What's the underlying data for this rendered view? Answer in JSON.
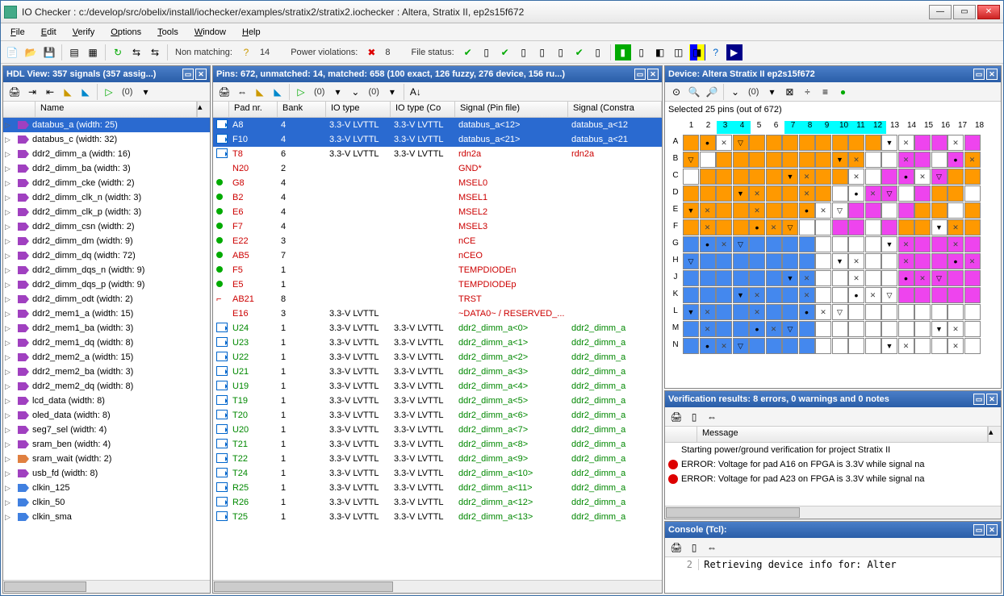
{
  "window": {
    "title": "IO Checker : c:/develop/src/obelix/install/iochecker/examples/stratix2/stratix2.iochecker : Altera, Stratix II, ep2s15f672"
  },
  "menu": [
    "File",
    "Edit",
    "Verify",
    "Options",
    "Tools",
    "Window",
    "Help"
  ],
  "toolbar": {
    "nonmatching_label": "Non matching:",
    "nonmatching_count": "14",
    "power_label": "Power violations:",
    "power_count": "8",
    "file_label": "File status:"
  },
  "hdl": {
    "title": "HDL View: 357 signals (357 assig...)",
    "filter_count": "(0)",
    "colhdr": "Name",
    "signals": [
      {
        "name": "databus_a (width: 25)",
        "icon": "purple",
        "sel": true
      },
      {
        "name": "databus_c (width: 32)",
        "icon": "purple"
      },
      {
        "name": "ddr2_dimm_a (width: 16)",
        "icon": "purple"
      },
      {
        "name": "ddr2_dimm_ba (width: 3)",
        "icon": "purple"
      },
      {
        "name": "ddr2_dimm_cke (width: 2)",
        "icon": "purple"
      },
      {
        "name": "ddr2_dimm_clk_n (width: 3)",
        "icon": "purple"
      },
      {
        "name": "ddr2_dimm_clk_p (width: 3)",
        "icon": "purple"
      },
      {
        "name": "ddr2_dimm_csn (width: 2)",
        "icon": "purple"
      },
      {
        "name": "ddr2_dimm_dm (width: 9)",
        "icon": "purple"
      },
      {
        "name": "ddr2_dimm_dq (width: 72)",
        "icon": "purple"
      },
      {
        "name": "ddr2_dimm_dqs_n (width: 9)",
        "icon": "purple"
      },
      {
        "name": "ddr2_dimm_dqs_p (width: 9)",
        "icon": "purple"
      },
      {
        "name": "ddr2_dimm_odt (width: 2)",
        "icon": "purple"
      },
      {
        "name": "ddr2_mem1_a (width: 15)",
        "icon": "purple"
      },
      {
        "name": "ddr2_mem1_ba (width: 3)",
        "icon": "purple"
      },
      {
        "name": "ddr2_mem1_dq (width: 8)",
        "icon": "purple"
      },
      {
        "name": "ddr2_mem2_a (width: 15)",
        "icon": "purple"
      },
      {
        "name": "ddr2_mem2_ba (width: 3)",
        "icon": "purple"
      },
      {
        "name": "ddr2_mem2_dq (width: 8)",
        "icon": "purple"
      },
      {
        "name": "lcd_data (width: 8)",
        "icon": "purple"
      },
      {
        "name": "oled_data (width: 8)",
        "icon": "purple"
      },
      {
        "name": "seg7_sel (width: 4)",
        "icon": "purple"
      },
      {
        "name": "sram_ben (width: 4)",
        "icon": "purple"
      },
      {
        "name": "sram_wait (width: 2)",
        "icon": "orange"
      },
      {
        "name": "usb_fd (width: 8)",
        "icon": "purple"
      },
      {
        "name": "clkin_125",
        "icon": "blue"
      },
      {
        "name": "clkin_50",
        "icon": "blue"
      },
      {
        "name": "clkin_sma",
        "icon": "blue"
      }
    ]
  },
  "pins": {
    "title": "Pins: 672, unmatched: 14, matched: 658 (100 exact, 126 fuzzy, 276 device, 156 ru...)",
    "filter1": "(0)",
    "filter2": "(0)",
    "cols": [
      "Pad nr.",
      "Bank",
      "IO type",
      "IO type (Co",
      "Signal (Pin file)",
      "Signal (Constra"
    ],
    "rows": [
      {
        "icon": "pin",
        "pad": "A8",
        "bank": "4",
        "io1": "3.3-V LVTTL",
        "io2": "3.3-V LVTTL",
        "sig1": "databus_a<12>",
        "sig2": "databus_a<12",
        "sel": true
      },
      {
        "icon": "pin",
        "pad": "F10",
        "bank": "4",
        "io1": "3.3-V LVTTL",
        "io2": "3.3-V LVTTL",
        "sig1": "databus_a<21>",
        "sig2": "databus_a<21",
        "sel": true
      },
      {
        "icon": "pin-red",
        "pad": "T8",
        "bank": "6",
        "io1": "3.3-V LVTTL",
        "io2": "3.3-V LVTTL",
        "sig1": "rdn2a",
        "sig2": "rdn2a",
        "cls": "red"
      },
      {
        "icon": "",
        "pad": "N20",
        "bank": "2",
        "io1": "",
        "io2": "",
        "sig1": "GND*",
        "sig2": "",
        "cls": "red"
      },
      {
        "icon": "dot",
        "pad": "G8",
        "bank": "4",
        "io1": "",
        "io2": "",
        "sig1": "MSEL0",
        "sig2": "",
        "cls": "red"
      },
      {
        "icon": "dot",
        "pad": "B2",
        "bank": "4",
        "io1": "",
        "io2": "",
        "sig1": "MSEL1",
        "sig2": "",
        "cls": "red"
      },
      {
        "icon": "dot",
        "pad": "E6",
        "bank": "4",
        "io1": "",
        "io2": "",
        "sig1": "MSEL2",
        "sig2": "",
        "cls": "red"
      },
      {
        "icon": "dot",
        "pad": "F7",
        "bank": "4",
        "io1": "",
        "io2": "",
        "sig1": "MSEL3",
        "sig2": "",
        "cls": "red"
      },
      {
        "icon": "dot",
        "pad": "E22",
        "bank": "3",
        "io1": "",
        "io2": "",
        "sig1": "nCE",
        "sig2": "",
        "cls": "red"
      },
      {
        "icon": "dot",
        "pad": "AB5",
        "bank": "7",
        "io1": "",
        "io2": "",
        "sig1": "nCEO",
        "sig2": "",
        "cls": "red"
      },
      {
        "icon": "dot",
        "pad": "F5",
        "bank": "1",
        "io1": "",
        "io2": "",
        "sig1": "TEMPDIODEn",
        "sig2": "",
        "cls": "red"
      },
      {
        "icon": "dot",
        "pad": "E5",
        "bank": "1",
        "io1": "",
        "io2": "",
        "sig1": "TEMPDIODEp",
        "sig2": "",
        "cls": "red"
      },
      {
        "icon": "step",
        "pad": "AB21",
        "bank": "8",
        "io1": "",
        "io2": "",
        "sig1": "TRST",
        "sig2": "",
        "cls": "red"
      },
      {
        "icon": "",
        "pad": "E16",
        "bank": "3",
        "io1": "3.3-V LVTTL",
        "io2": "",
        "sig1": "~DATA0~ / RESERVED_...",
        "sig2": "",
        "cls": "red"
      },
      {
        "icon": "pin-g",
        "pad": "U24",
        "bank": "1",
        "io1": "3.3-V LVTTL",
        "io2": "3.3-V LVTTL",
        "sig1": "ddr2_dimm_a<0>",
        "sig2": "ddr2_dimm_a",
        "cls": "green"
      },
      {
        "icon": "pin-g",
        "pad": "U23",
        "bank": "1",
        "io1": "3.3-V LVTTL",
        "io2": "3.3-V LVTTL",
        "sig1": "ddr2_dimm_a<1>",
        "sig2": "ddr2_dimm_a",
        "cls": "green"
      },
      {
        "icon": "pin-g",
        "pad": "U22",
        "bank": "1",
        "io1": "3.3-V LVTTL",
        "io2": "3.3-V LVTTL",
        "sig1": "ddr2_dimm_a<2>",
        "sig2": "ddr2_dimm_a",
        "cls": "green"
      },
      {
        "icon": "pin-g",
        "pad": "U21",
        "bank": "1",
        "io1": "3.3-V LVTTL",
        "io2": "3.3-V LVTTL",
        "sig1": "ddr2_dimm_a<3>",
        "sig2": "ddr2_dimm_a",
        "cls": "green"
      },
      {
        "icon": "pin-g",
        "pad": "U19",
        "bank": "1",
        "io1": "3.3-V LVTTL",
        "io2": "3.3-V LVTTL",
        "sig1": "ddr2_dimm_a<4>",
        "sig2": "ddr2_dimm_a",
        "cls": "green"
      },
      {
        "icon": "pin-g",
        "pad": "T19",
        "bank": "1",
        "io1": "3.3-V LVTTL",
        "io2": "3.3-V LVTTL",
        "sig1": "ddr2_dimm_a<5>",
        "sig2": "ddr2_dimm_a",
        "cls": "green"
      },
      {
        "icon": "pin-g",
        "pad": "T20",
        "bank": "1",
        "io1": "3.3-V LVTTL",
        "io2": "3.3-V LVTTL",
        "sig1": "ddr2_dimm_a<6>",
        "sig2": "ddr2_dimm_a",
        "cls": "green"
      },
      {
        "icon": "pin-g",
        "pad": "U20",
        "bank": "1",
        "io1": "3.3-V LVTTL",
        "io2": "3.3-V LVTTL",
        "sig1": "ddr2_dimm_a<7>",
        "sig2": "ddr2_dimm_a",
        "cls": "green"
      },
      {
        "icon": "pin-g",
        "pad": "T21",
        "bank": "1",
        "io1": "3.3-V LVTTL",
        "io2": "3.3-V LVTTL",
        "sig1": "ddr2_dimm_a<8>",
        "sig2": "ddr2_dimm_a",
        "cls": "green"
      },
      {
        "icon": "pin-g",
        "pad": "T22",
        "bank": "1",
        "io1": "3.3-V LVTTL",
        "io2": "3.3-V LVTTL",
        "sig1": "ddr2_dimm_a<9>",
        "sig2": "ddr2_dimm_a",
        "cls": "green"
      },
      {
        "icon": "pin-g",
        "pad": "T24",
        "bank": "1",
        "io1": "3.3-V LVTTL",
        "io2": "3.3-V LVTTL",
        "sig1": "ddr2_dimm_a<10>",
        "sig2": "ddr2_dimm_a",
        "cls": "green"
      },
      {
        "icon": "pin-g",
        "pad": "R25",
        "bank": "1",
        "io1": "3.3-V LVTTL",
        "io2": "3.3-V LVTTL",
        "sig1": "ddr2_dimm_a<11>",
        "sig2": "ddr2_dimm_a",
        "cls": "green"
      },
      {
        "icon": "pin-g",
        "pad": "R26",
        "bank": "1",
        "io1": "3.3-V LVTTL",
        "io2": "3.3-V LVTTL",
        "sig1": "ddr2_dimm_a<12>",
        "sig2": "ddr2_dimm_a",
        "cls": "green"
      },
      {
        "icon": "pin-g",
        "pad": "T25",
        "bank": "1",
        "io1": "3.3-V LVTTL",
        "io2": "3.3-V LVTTL",
        "sig1": "ddr2_dimm_a<13>",
        "sig2": "ddr2_dimm_a",
        "cls": "green"
      }
    ]
  },
  "device": {
    "title": "Device: Altera Stratix II ep2s15f672",
    "filter": "(0)",
    "selected": "Selected 25 pins (out of 672)",
    "cols": [
      "1",
      "2",
      "3",
      "4",
      "5",
      "6",
      "7",
      "8",
      "9",
      "10",
      "11",
      "12",
      "13",
      "14",
      "15",
      "16",
      "17",
      "18"
    ],
    "col_hl": [
      2,
      3,
      6,
      7,
      8,
      9,
      10,
      11
    ],
    "rows": [
      "A",
      "B",
      "C",
      "D",
      "E",
      "F",
      "G",
      "H",
      "J",
      "K",
      "L",
      "M",
      "N"
    ],
    "row_hl": []
  },
  "verify": {
    "title": "Verification results: 8 errors, 0 warnings and 0 notes",
    "col": "Message",
    "msgs": [
      {
        "icon": "",
        "text": "Starting power/ground verification for project Stratix II"
      },
      {
        "icon": "err",
        "text": "ERROR: Voltage for pad A16 on FPGA is 3.3V while signal na"
      },
      {
        "icon": "err",
        "text": "ERROR: Voltage for pad A23 on FPGA is 3.3V while signal na"
      }
    ]
  },
  "console": {
    "title": "Console (Tcl):",
    "line_no": "2",
    "line": "Retrieving device info for: Alter"
  }
}
